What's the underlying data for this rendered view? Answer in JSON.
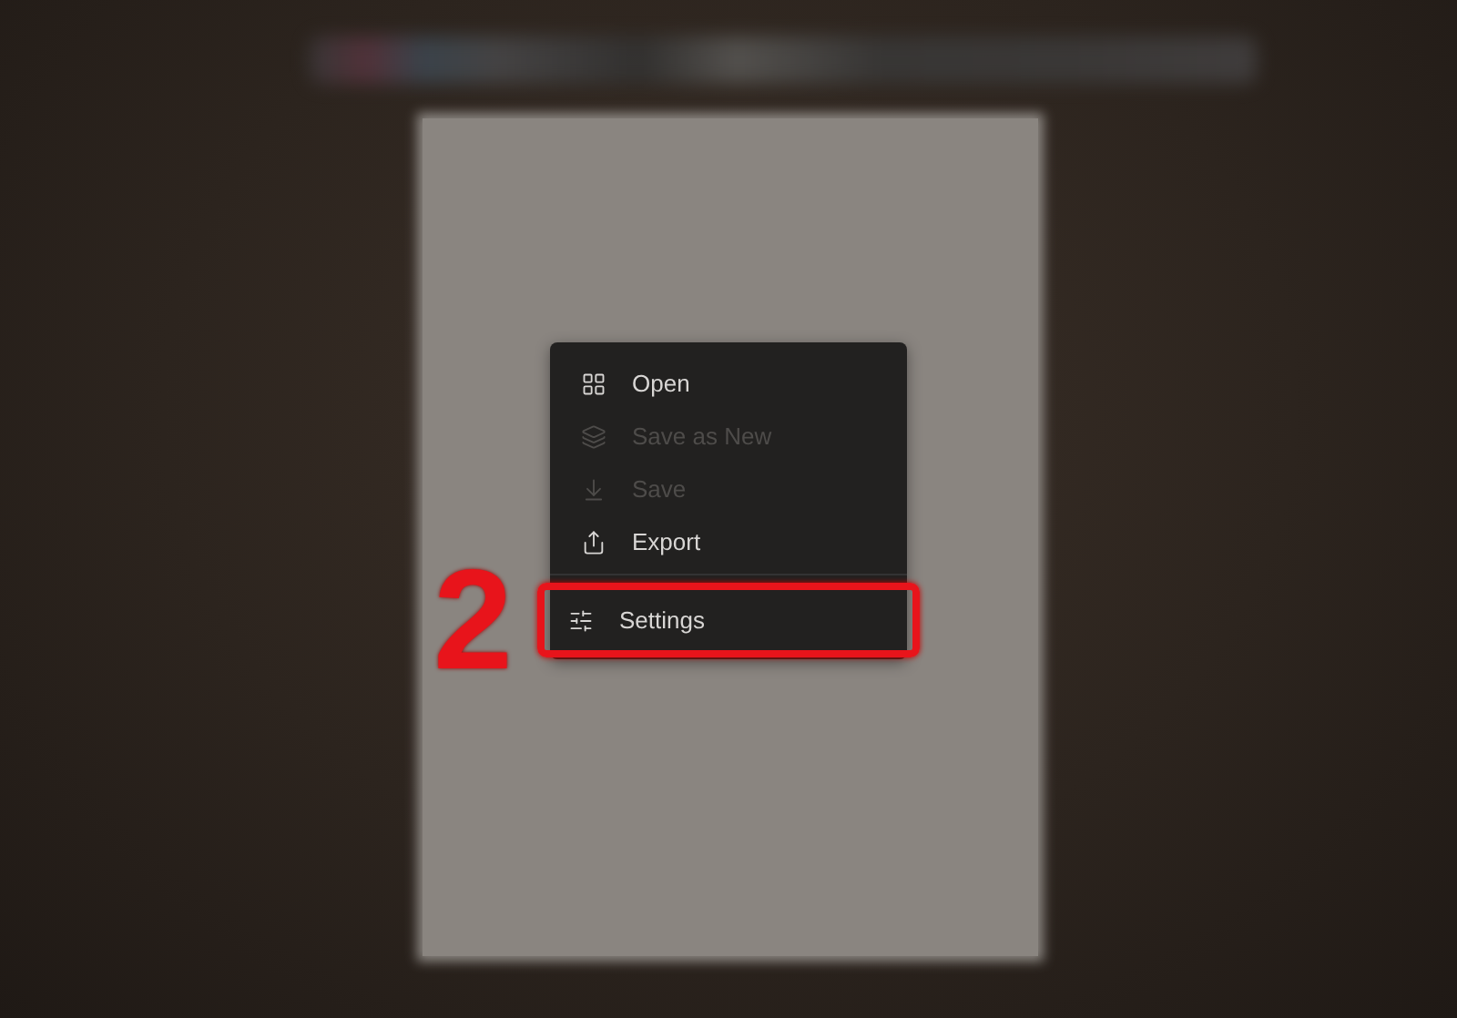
{
  "menu": {
    "items": [
      {
        "label": "Open",
        "disabled": false,
        "highlighted": false
      },
      {
        "label": "Save as New",
        "disabled": true,
        "highlighted": false
      },
      {
        "label": "Save",
        "disabled": true,
        "highlighted": false
      },
      {
        "label": "Export",
        "disabled": false,
        "highlighted": false
      },
      {
        "label": "Settings",
        "disabled": false,
        "highlighted": true
      }
    ]
  },
  "annotation": {
    "step_number": "2"
  }
}
